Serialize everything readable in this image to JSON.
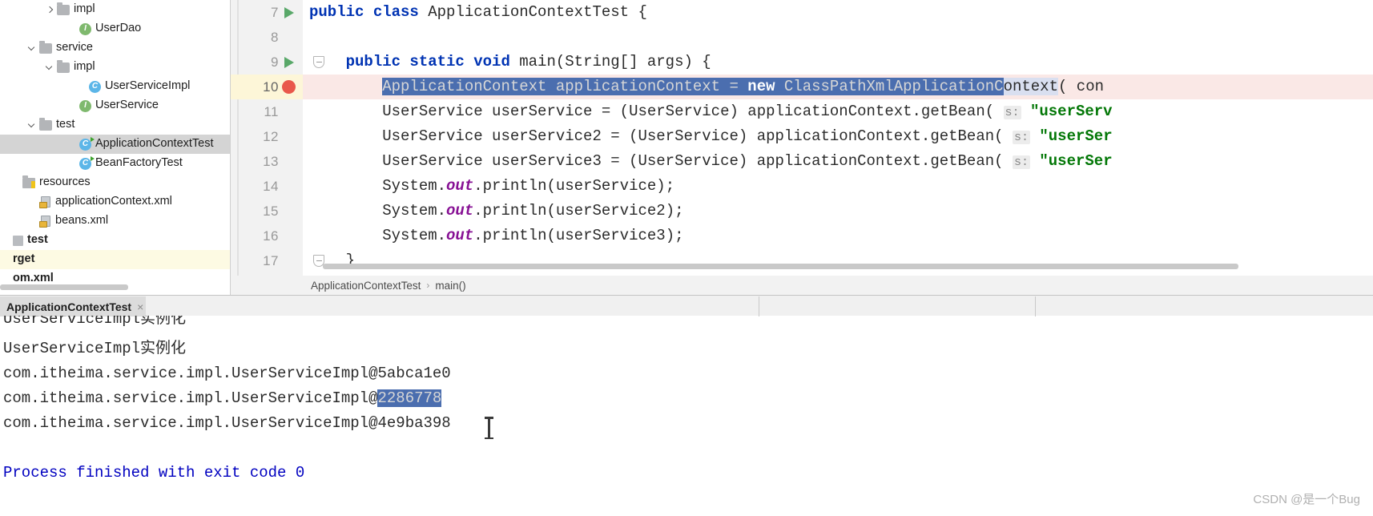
{
  "project_tree": {
    "rows": [
      {
        "indent": 55,
        "arrow": "right",
        "icon": "folder",
        "label": "impl",
        "state": "normal"
      },
      {
        "indent": 83,
        "arrow": "none",
        "icon": "interface",
        "label": "UserDao",
        "state": "normal"
      },
      {
        "indent": 33,
        "arrow": "down",
        "icon": "folder",
        "label": "service",
        "state": "normal"
      },
      {
        "indent": 55,
        "arrow": "down",
        "icon": "folder",
        "label": "impl",
        "state": "normal"
      },
      {
        "indent": 95,
        "arrow": "none",
        "icon": "class",
        "label": "UserServiceImpl",
        "state": "normal"
      },
      {
        "indent": 83,
        "arrow": "none",
        "icon": "interface",
        "label": "UserService",
        "state": "normal"
      },
      {
        "indent": 33,
        "arrow": "down",
        "icon": "folder",
        "label": "test",
        "state": "normal"
      },
      {
        "indent": 83,
        "arrow": "none",
        "icon": "class-run",
        "label": "ApplicationContextTest",
        "state": "selected"
      },
      {
        "indent": 83,
        "arrow": "none",
        "icon": "class-run",
        "label": "BeanFactoryTest",
        "state": "normal"
      },
      {
        "indent": 12,
        "arrow": "none",
        "icon": "folder-src",
        "label": "resources",
        "state": "normal"
      },
      {
        "indent": 33,
        "arrow": "none",
        "icon": "xml",
        "label": "applicationContext.xml",
        "state": "normal"
      },
      {
        "indent": 33,
        "arrow": "none",
        "icon": "xml",
        "label": "beans.xml",
        "state": "normal"
      },
      {
        "indent": -6,
        "arrow": "none",
        "icon": "module",
        "label": "test",
        "state": "normal"
      },
      {
        "indent": -6,
        "arrow": "none",
        "icon": "none",
        "label": "rget",
        "state": "yellow"
      },
      {
        "indent": -6,
        "arrow": "none",
        "icon": "none",
        "label": "om.xml",
        "state": "normal"
      }
    ]
  },
  "editor": {
    "lines": [
      {
        "num": "7",
        "run_marker": true,
        "fold": false,
        "current": false,
        "segments": [
          {
            "text": "public class ",
            "cls": "kw"
          },
          {
            "text": "ApplicationContextTest ",
            "cls": ""
          },
          {
            "text": "{",
            "cls": ""
          }
        ]
      },
      {
        "num": "8",
        "run_marker": false,
        "fold": false,
        "current": false,
        "segments": []
      },
      {
        "num": "9",
        "run_marker": true,
        "fold": true,
        "current": false,
        "segments": [
          {
            "text": "    ",
            "cls": ""
          },
          {
            "text": "public static void ",
            "cls": "kw"
          },
          {
            "text": "main(String[] args) {",
            "cls": ""
          }
        ]
      },
      {
        "num": "10",
        "run_marker": false,
        "breakpoint": true,
        "fold": false,
        "current": true,
        "segments": [
          {
            "text": "        ",
            "cls": ""
          },
          {
            "text": "ApplicationContext applicationContext = ",
            "cls": "sel"
          },
          {
            "text": "new ",
            "cls": "sel kw-sel"
          },
          {
            "text": "ClassPathXmlApplicationC",
            "cls": "sel"
          },
          {
            "text": "ontext",
            "cls": "sel-fade"
          },
          {
            "text": "( con",
            "cls": ""
          }
        ]
      },
      {
        "num": "11",
        "run_marker": false,
        "fold": false,
        "current": false,
        "segments": [
          {
            "text": "        UserService userService = (UserService) applicationContext.getBean( ",
            "cls": ""
          },
          {
            "text": "s:",
            "cls": "param-hint"
          },
          {
            "text": " ",
            "cls": ""
          },
          {
            "text": "\"userServ",
            "cls": "str"
          }
        ]
      },
      {
        "num": "12",
        "run_marker": false,
        "fold": false,
        "current": false,
        "segments": [
          {
            "text": "        UserService userService2 = (UserService) applicationContext.getBean( ",
            "cls": ""
          },
          {
            "text": "s:",
            "cls": "param-hint"
          },
          {
            "text": " ",
            "cls": ""
          },
          {
            "text": "\"userSer",
            "cls": "str"
          }
        ]
      },
      {
        "num": "13",
        "run_marker": false,
        "fold": false,
        "current": false,
        "segments": [
          {
            "text": "        UserService userService3 = (UserService) applicationContext.getBean( ",
            "cls": ""
          },
          {
            "text": "s:",
            "cls": "param-hint"
          },
          {
            "text": " ",
            "cls": ""
          },
          {
            "text": "\"userSer",
            "cls": "str"
          }
        ]
      },
      {
        "num": "14",
        "run_marker": false,
        "fold": false,
        "current": false,
        "segments": [
          {
            "text": "        System.",
            "cls": ""
          },
          {
            "text": "out",
            "cls": "fld"
          },
          {
            "text": ".println(userService);",
            "cls": ""
          }
        ]
      },
      {
        "num": "15",
        "run_marker": false,
        "fold": false,
        "current": false,
        "segments": [
          {
            "text": "        System.",
            "cls": ""
          },
          {
            "text": "out",
            "cls": "fld"
          },
          {
            "text": ".println(userService2);",
            "cls": ""
          }
        ]
      },
      {
        "num": "16",
        "run_marker": false,
        "fold": false,
        "current": false,
        "segments": [
          {
            "text": "        System.",
            "cls": ""
          },
          {
            "text": "out",
            "cls": "fld"
          },
          {
            "text": ".println(userService3);",
            "cls": ""
          }
        ]
      },
      {
        "num": "17",
        "run_marker": false,
        "fold": true,
        "current": false,
        "segments": [
          {
            "text": "    }",
            "cls": ""
          }
        ]
      }
    ],
    "breadcrumb": {
      "class": "ApplicationContextTest",
      "separator": "›",
      "method": "main()"
    }
  },
  "run_panel": {
    "tab_label": "ApplicationContextTest",
    "tab_close": "×",
    "console_lines": [
      {
        "text": "UserServiceImpl实例化",
        "clipped": true
      },
      {
        "text": "UserServiceImpl实例化",
        "clipped": false
      },
      {
        "prefix": "com.itheima.service.impl.UserServiceImpl@",
        "hash": "5abca1e0",
        "selected": false
      },
      {
        "prefix": "com.itheima.service.impl.UserServiceImpl@",
        "hash": "2286778",
        "selected": true
      },
      {
        "prefix": "com.itheima.service.impl.UserServiceImpl@",
        "hash": "4e9ba398",
        "selected": false
      },
      {
        "text": "",
        "blank": true
      },
      {
        "text": "Process finished with exit code 0",
        "exit": true
      }
    ]
  },
  "watermark": {
    "text": "CSDN @是一个Bug"
  },
  "colors": {
    "selection_blue": "#4b6eaf",
    "breakpoint_red": "#e9584b",
    "run_green": "#59a869",
    "keyword_blue": "#0033b3",
    "string_green": "#027706",
    "field_purple": "#871094",
    "current_line_pink": "#fae8e6",
    "gutter_gray": "#f2f2f2"
  }
}
